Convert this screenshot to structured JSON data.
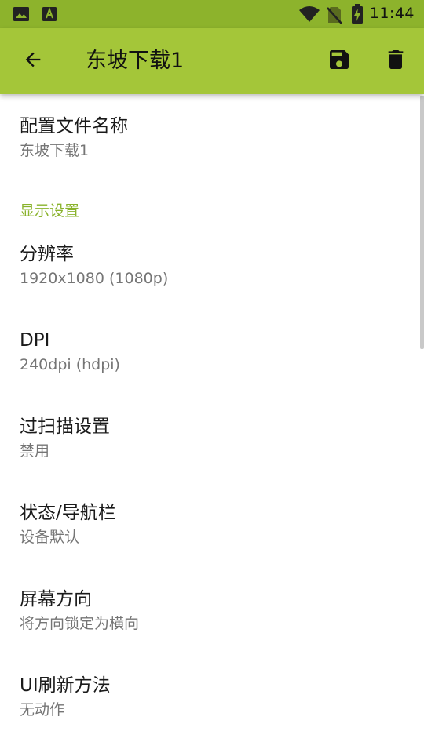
{
  "status_bar": {
    "time": "11:44",
    "icons": [
      "gallery-icon",
      "font-a-icon",
      "wifi-icon",
      "no-sim-icon",
      "battery-charging-icon"
    ]
  },
  "toolbar": {
    "title": "东坡下载1",
    "back_icon": "arrow-left-icon",
    "save_icon": "floppy-disk-icon",
    "delete_icon": "trash-icon"
  },
  "colors": {
    "status_bar": "#8db32c",
    "toolbar": "#a4c639",
    "accent": "#8ab32c",
    "title_text": "#1a1a1a",
    "summary_text": "#757575"
  },
  "profile": {
    "title": "配置文件名称",
    "summary": "东坡下载1"
  },
  "display_category": "显示设置",
  "prefs": [
    {
      "title": "分辨率",
      "summary": "1920x1080 (1080p)"
    },
    {
      "title": "DPI",
      "summary": "240dpi (hdpi)"
    },
    {
      "title": "过扫描设置",
      "summary": "禁用"
    },
    {
      "title": "状态/导航栏",
      "summary": "设备默认"
    },
    {
      "title": "屏幕方向",
      "summary": "将方向锁定为横向"
    },
    {
      "title": "UI刷新方法",
      "summary": "无动作"
    }
  ]
}
